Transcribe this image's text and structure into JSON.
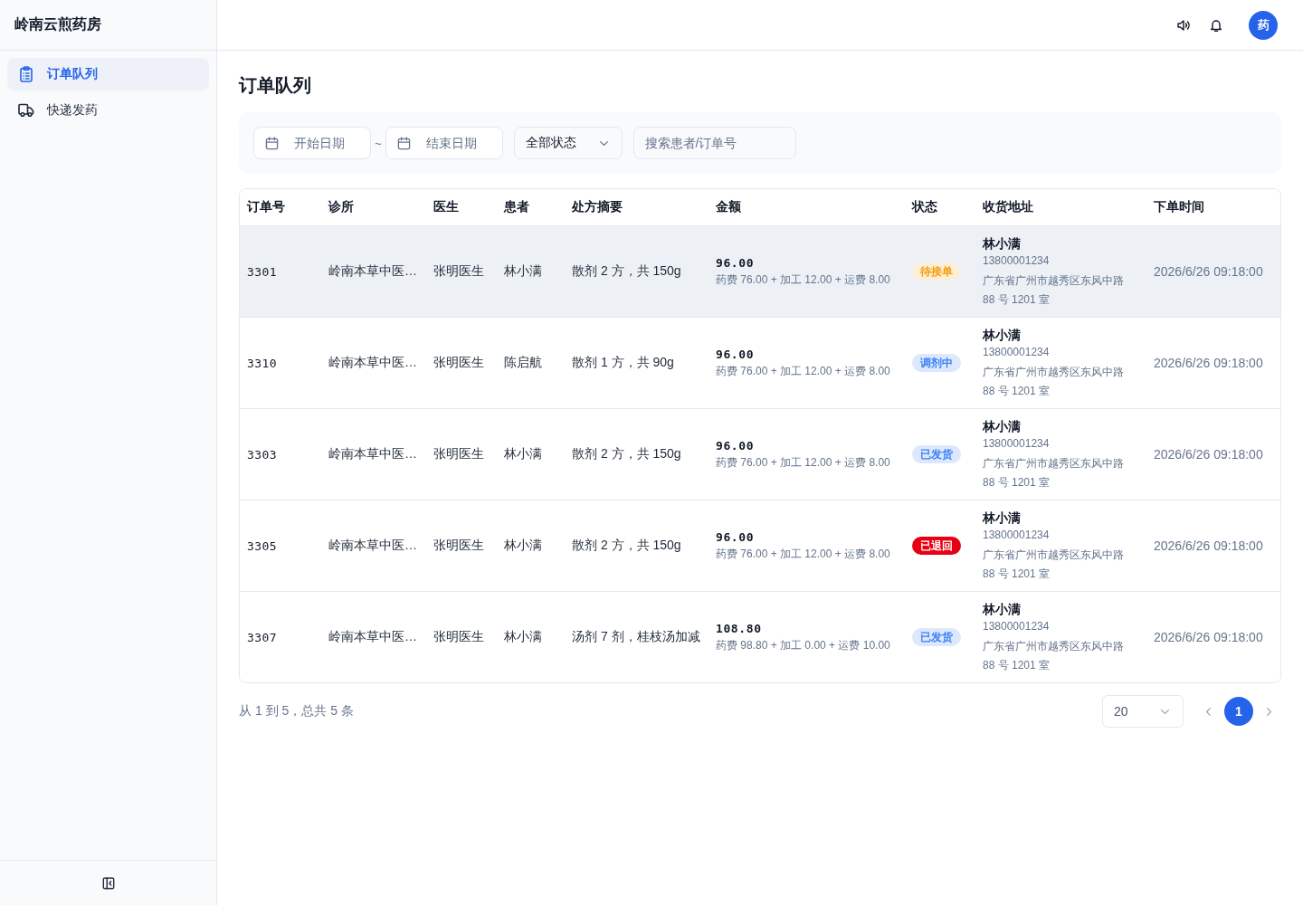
{
  "sidebar": {
    "title": "岭南云煎药房",
    "items": [
      {
        "label": "订单队列",
        "selected": true
      },
      {
        "label": "快递发药",
        "selected": false
      }
    ]
  },
  "header": {
    "avatar": "药"
  },
  "page": {
    "title": "订单队列"
  },
  "filters": {
    "start_date": {
      "placeholder": "开始日期"
    },
    "separator": "~",
    "end_date": {
      "placeholder": "结束日期"
    },
    "status": {
      "value": "全部状态"
    },
    "search": {
      "placeholder": "搜索患者/订单号"
    }
  },
  "table": {
    "columns": [
      "订单号",
      "诊所",
      "医生",
      "患者",
      "处方摘要",
      "金额",
      "状态",
      "收货地址",
      "下单时间"
    ],
    "rows": [
      {
        "selected": true,
        "order_no": "3301",
        "clinic": "岭南本草中医…",
        "doctor": "张明医生",
        "patient": "林小满",
        "summary": "散剂 2 方，共 150g",
        "amount": "96.00",
        "amount_detail": "药费 76.00 + 加工 12.00 + 运费 8.00",
        "status": {
          "label": "待接单",
          "kind": "pending"
        },
        "recipient": {
          "name": "林小满",
          "phone": "13800001234",
          "address": "广东省广州市越秀区东风中路 88 号 1201 室"
        },
        "time": "2026/6/26 09:18:00"
      },
      {
        "selected": false,
        "order_no": "3310",
        "clinic": "岭南本草中医…",
        "doctor": "张明医生",
        "patient": "陈启航",
        "summary": "散剂 1 方，共 90g",
        "amount": "96.00",
        "amount_detail": "药费 76.00 + 加工 12.00 + 运费 8.00",
        "status": {
          "label": "调剂中",
          "kind": "processing"
        },
        "recipient": {
          "name": "林小满",
          "phone": "13800001234",
          "address": "广东省广州市越秀区东风中路 88 号 1201 室"
        },
        "time": "2026/6/26 09:18:00"
      },
      {
        "selected": false,
        "order_no": "3303",
        "clinic": "岭南本草中医…",
        "doctor": "张明医生",
        "patient": "林小满",
        "summary": "散剂 2 方，共 150g",
        "amount": "96.00",
        "amount_detail": "药费 76.00 + 加工 12.00 + 运费 8.00",
        "status": {
          "label": "已发货",
          "kind": "shipped"
        },
        "recipient": {
          "name": "林小满",
          "phone": "13800001234",
          "address": "广东省广州市越秀区东风中路 88 号 1201 室"
        },
        "time": "2026/6/26 09:18:00"
      },
      {
        "selected": false,
        "order_no": "3305",
        "clinic": "岭南本草中医…",
        "doctor": "张明医生",
        "patient": "林小满",
        "summary": "散剂 2 方，共 150g",
        "amount": "96.00",
        "amount_detail": "药费 76.00 + 加工 12.00 + 运费 8.00",
        "status": {
          "label": "已退回",
          "kind": "returned"
        },
        "recipient": {
          "name": "林小满",
          "phone": "13800001234",
          "address": "广东省广州市越秀区东风中路 88 号 1201 室"
        },
        "time": "2026/6/26 09:18:00"
      },
      {
        "selected": false,
        "order_no": "3307",
        "clinic": "岭南本草中医…",
        "doctor": "张明医生",
        "patient": "林小满",
        "summary": "汤剂 7 剂，桂枝汤加减",
        "amount": "108.80",
        "amount_detail": "药费 98.80 + 加工 0.00 + 运费 10.00",
        "status": {
          "label": "已发货",
          "kind": "shipped"
        },
        "recipient": {
          "name": "林小满",
          "phone": "13800001234",
          "address": "广东省广州市越秀区东风中路 88 号 1201 室"
        },
        "time": "2026/6/26 09:18:00"
      }
    ]
  },
  "footer": {
    "summary": "从 1 到 5，总共 5 条",
    "page_size": "20",
    "pages": [
      {
        "label": "1",
        "selected": true
      }
    ]
  }
}
